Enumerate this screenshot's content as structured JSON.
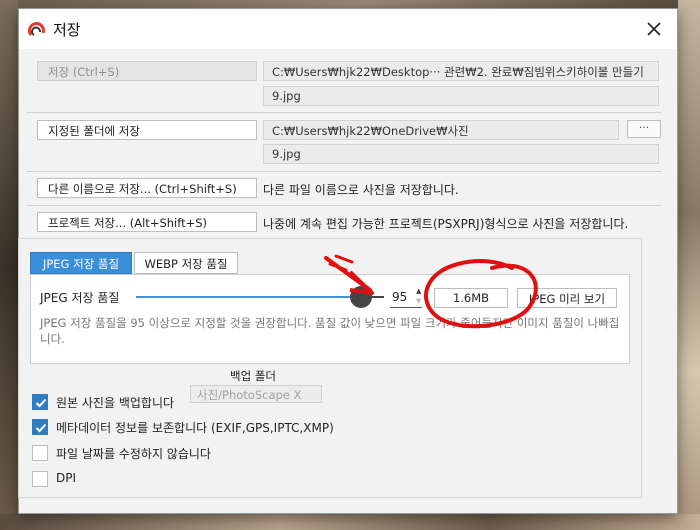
{
  "window": {
    "title": "저장"
  },
  "rows": {
    "save": {
      "label": "저장 (Ctrl+S)",
      "path": "C:₩Users₩hjk22₩Desktop··· 관련₩2. 완료₩짐빔위스키하이볼 만들기",
      "filename": "9.jpg"
    },
    "save_to_folder": {
      "label": "지정된 폴더에 저장",
      "path": "C:₩Users₩hjk22₩OneDrive₩사진",
      "browse": "···",
      "filename": "9.jpg"
    },
    "save_as": {
      "label": "다른 이름으로 저장... (Ctrl+Shift+S)",
      "description": "다른 파일 이름으로 사진을 저장합니다."
    },
    "save_project": {
      "label": "프로젝트 저장... (Alt+Shift+S)",
      "description": "나중에 계속 편집 가능한 프로젝트(PSXPRJ)형식으로 사진을 저장합니다."
    }
  },
  "quality": {
    "tabs": [
      {
        "label": "JPEG 저장 품질"
      },
      {
        "label": "WEBP 저장 품질"
      }
    ],
    "label": "JPEG 저장 품질",
    "value": "95",
    "slider_fraction": 0.95,
    "file_size": "1.6MB",
    "preview_label": "JPEG 미리 보기",
    "note": "JPEG 저장 품질을 95 이상으로 지정할 것을 권장합니다. 품질 값이 낮으면 파일 크기가 줄어들지만 이미지 품질이 나빠집니다."
  },
  "backup": {
    "folder_label": "백업 폴더",
    "folder_value": "사진/PhotoScape X",
    "options": [
      {
        "label": "원본 사진을 백업합니다",
        "checked": true
      },
      {
        "label": "메타데이터 정보를 보존합니다 (EXIF,GPS,IPTC,XMP)",
        "checked": true
      },
      {
        "label": "파일 날짜를 수정하지 않습니다",
        "checked": false
      },
      {
        "label": "DPI",
        "checked": false
      }
    ]
  },
  "colors": {
    "accent": "#3b8fd8",
    "annotation": "#e01010",
    "slider_thumb": "#454545"
  }
}
